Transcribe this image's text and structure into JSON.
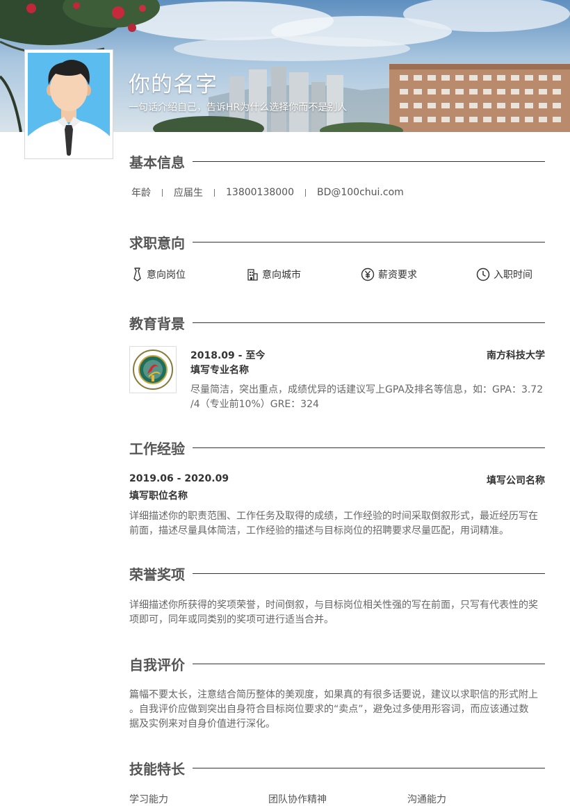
{
  "header": {
    "name": "你的名字",
    "tagline": "一句话介绍自己，告诉HR为什么选择你而不是别人"
  },
  "basic_info": {
    "title": "基本信息",
    "items": [
      "年龄",
      "应届生",
      "13800138000",
      "BD@100chui.com"
    ]
  },
  "job_intent": {
    "title": "求职意向",
    "items": [
      {
        "icon": "tie-icon",
        "label": "意向岗位"
      },
      {
        "icon": "building-icon",
        "label": "意向城市"
      },
      {
        "icon": "yuan-icon",
        "label": "薪资要求"
      },
      {
        "icon": "clock-icon",
        "label": "入职时间"
      }
    ]
  },
  "education": {
    "title": "教育背景",
    "period": "2018.09 - 至今",
    "school": "南方科技大学",
    "major": "填写专业名称",
    "desc_line1": "尽量简洁，突出重点，成绩优异的话建议写上GPA及排名等信息，如：GPA：3.72",
    "desc_line2": "/4（专业前10%）GRE：324"
  },
  "work": {
    "title": "工作经验",
    "period": "2019.06 - 2020.09",
    "company": "填写公司名称",
    "position": "填写职位名称",
    "desc_line1": "详细描述你的职责范围、工作任务及取得的成绩，工作经验的时间采取倒叙形式，最近经历写在",
    "desc_line2": "前面，描述尽量具体简洁，工作经验的描述与目标岗位的招聘要求尽量匹配，用词精准。"
  },
  "honors": {
    "title": "荣誉奖项",
    "desc_line1": "详细描述你所获得的奖项荣誉，时间倒叙，与目标岗位相关性强的写在前面，只写有代表性的奖",
    "desc_line2": "项即可，同年或同类别的奖项可进行适当合并。"
  },
  "self_eval": {
    "title": "自我评价",
    "desc_line1": "篇幅不要太长，注意结合简历整体的美观度，如果真的有很多话要说，建议以求职信的形式附上",
    "desc_line2": "。自我评价应做到突出自身符合目标岗位要求的“卖点”，避免过多使用形容词，而应该通过数",
    "desc_line3": "据及实例来对自身价值进行深化。"
  },
  "skills": {
    "title": "技能特长",
    "items": [
      "学习能力",
      "团队协作精神",
      "沟通能力"
    ]
  }
}
